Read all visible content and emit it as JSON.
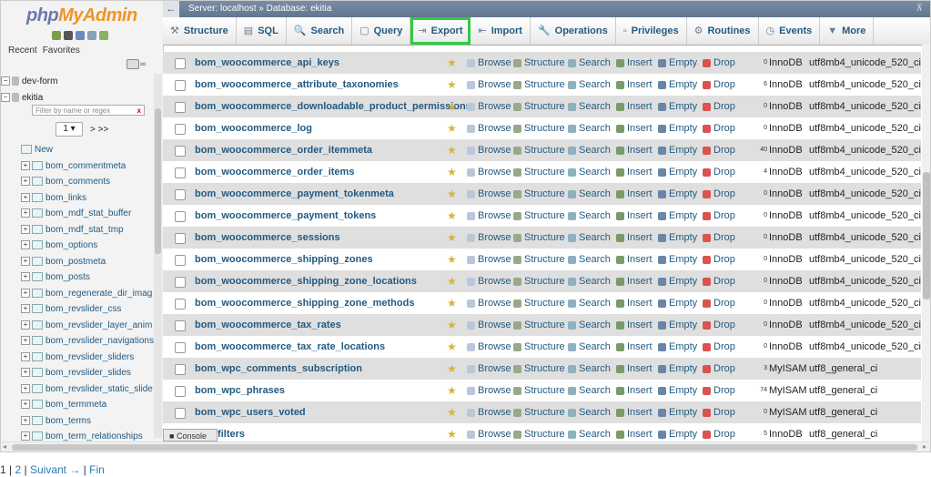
{
  "logo": {
    "php": "php",
    "myadmin": "MyAdmin"
  },
  "nav": {
    "recent": "Recent",
    "favorites": "Favorites",
    "filter_placeholder": "Filter by name or regex",
    "page_number": "1",
    "page_next": "> >>",
    "db_devform": "dev-form",
    "db_ekitia": "ekitia",
    "new_label": "New",
    "tables": [
      "bom_commentmeta",
      "bom_comments",
      "bom_links",
      "bom_mdf_stat_buffer",
      "bom_mdf_stat_tmp",
      "bom_options",
      "bom_postmeta",
      "bom_posts",
      "bom_regenerate_dir_imag",
      "bom_revslider_css",
      "bom_revslider_layer_anim",
      "bom_revslider_navigations",
      "bom_revslider_sliders",
      "bom_revslider_slides",
      "bom_revslider_static_slide",
      "bom_termmeta",
      "bom_terms",
      "bom_term_relationships"
    ]
  },
  "topbar": {
    "back": "←",
    "crumb": "Server: localhost » Database: ekitia",
    "minimize": "⊼"
  },
  "menu": {
    "tabs": [
      {
        "label": "Structure",
        "icon": "⚒"
      },
      {
        "label": "SQL",
        "icon": "▤"
      },
      {
        "label": "Search",
        "icon": "🔍"
      },
      {
        "label": "Query",
        "icon": "▢"
      },
      {
        "label": "Export",
        "icon": "⇥"
      },
      {
        "label": "Import",
        "icon": "⇤"
      },
      {
        "label": "Operations",
        "icon": "🔧"
      },
      {
        "label": "Privileges",
        "icon": "▫"
      },
      {
        "label": "Routines",
        "icon": "⚙"
      },
      {
        "label": "Events",
        "icon": "◷"
      },
      {
        "label": "More",
        "icon": "▼"
      }
    ]
  },
  "actions": {
    "browse": "Browse",
    "structure": "Structure",
    "search": "Search",
    "insert": "Insert",
    "empty": "Empty",
    "drop": "Drop"
  },
  "rows": [
    {
      "name": "bom_woocommerce_api_keys",
      "count": "0",
      "engine": "InnoDB",
      "collation": "utf8mb4_unicode_520_ci"
    },
    {
      "name": "bom_woocommerce_attribute_taxonomies",
      "count": "6",
      "engine": "InnoDB",
      "collation": "utf8mb4_unicode_520_ci"
    },
    {
      "name": "bom_woocommerce_downloadable_product_permissions",
      "count": "0",
      "engine": "InnoDB",
      "collation": "utf8mb4_unicode_520_ci"
    },
    {
      "name": "bom_woocommerce_log",
      "count": "0",
      "engine": "InnoDB",
      "collation": "utf8mb4_unicode_520_ci"
    },
    {
      "name": "bom_woocommerce_order_itemmeta",
      "count": "40",
      "engine": "InnoDB",
      "collation": "utf8mb4_unicode_520_ci"
    },
    {
      "name": "bom_woocommerce_order_items",
      "count": "4",
      "engine": "InnoDB",
      "collation": "utf8mb4_unicode_520_ci"
    },
    {
      "name": "bom_woocommerce_payment_tokenmeta",
      "count": "0",
      "engine": "InnoDB",
      "collation": "utf8mb4_unicode_520_ci"
    },
    {
      "name": "bom_woocommerce_payment_tokens",
      "count": "0",
      "engine": "InnoDB",
      "collation": "utf8mb4_unicode_520_ci"
    },
    {
      "name": "bom_woocommerce_sessions",
      "count": "0",
      "engine": "InnoDB",
      "collation": "utf8mb4_unicode_520_ci"
    },
    {
      "name": "bom_woocommerce_shipping_zones",
      "count": "0",
      "engine": "InnoDB",
      "collation": "utf8mb4_unicode_520_ci"
    },
    {
      "name": "bom_woocommerce_shipping_zone_locations",
      "count": "0",
      "engine": "InnoDB",
      "collation": "utf8mb4_unicode_520_ci"
    },
    {
      "name": "bom_woocommerce_shipping_zone_methods",
      "count": "0",
      "engine": "InnoDB",
      "collation": "utf8mb4_unicode_520_ci"
    },
    {
      "name": "bom_woocommerce_tax_rates",
      "count": "0",
      "engine": "InnoDB",
      "collation": "utf8mb4_unicode_520_ci"
    },
    {
      "name": "bom_woocommerce_tax_rate_locations",
      "count": "0",
      "engine": "InnoDB",
      "collation": "utf8mb4_unicode_520_ci"
    },
    {
      "name": "bom_wpc_comments_subscription",
      "count": "3",
      "engine": "MyISAM",
      "collation": "utf8_general_ci"
    },
    {
      "name": "bom_wpc_phrases",
      "count": "74",
      "engine": "MyISAM",
      "collation": "utf8_general_ci"
    },
    {
      "name": "bom_wpc_users_voted",
      "count": "0",
      "engine": "MyISAM",
      "collation": "utf8_general_ci"
    },
    {
      "name": "wpf_filters",
      "count": "5",
      "engine": "InnoDB",
      "collation": "utf8_general_ci"
    }
  ],
  "console": "Console",
  "pagination": {
    "current": "1",
    "sep1": " | ",
    "page2": "2",
    "sep2": " | ",
    "next": "Suivant →",
    "sep3": " | ",
    "last": "Fin"
  }
}
